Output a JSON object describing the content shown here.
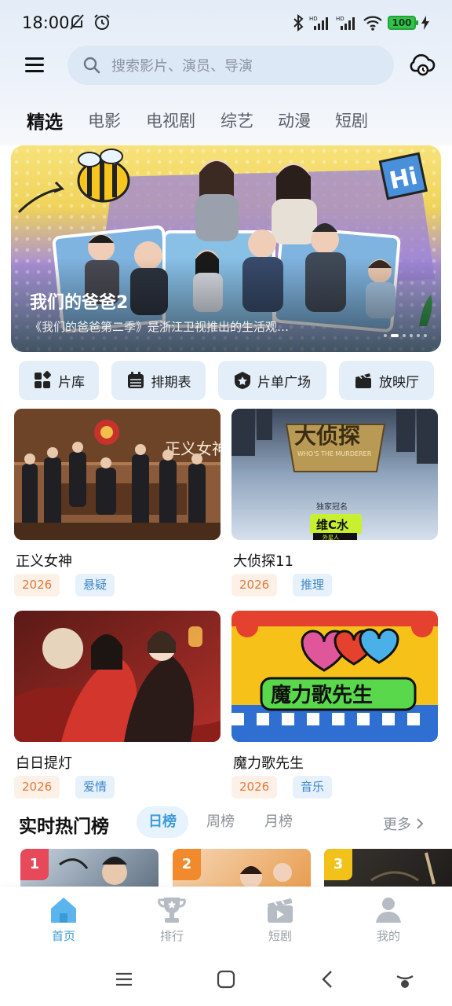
{
  "status_bar": {
    "time": "18:00",
    "battery": "100"
  },
  "search": {
    "placeholder": "搜索影片、演员、导演"
  },
  "category_tabs": [
    "精选",
    "电影",
    "电视剧",
    "综艺",
    "动漫",
    "短剧"
  ],
  "banner": {
    "title": "我们的爸爸2",
    "description": "《我们的爸爸第二季》是浙江卫视推出的生活观…"
  },
  "quick_links": [
    "片库",
    "排期表",
    "片单广场",
    "放映厅"
  ],
  "media": [
    {
      "title": "正义女神",
      "year": "2026",
      "genre": "悬疑"
    },
    {
      "title": "大侦探11",
      "year": "2026",
      "genre": "推理"
    },
    {
      "title": "白日提灯",
      "year": "2026",
      "genre": "爱情"
    },
    {
      "title": "魔力歌先生",
      "year": "2026",
      "genre": "音乐"
    }
  ],
  "thumb_texts": {
    "justice": "正义女神",
    "detective": "大侦探",
    "detective_sub": "WHO'S THE MURDERER",
    "sponsor_line": "独家冠名",
    "sponsor_brand": "维C水",
    "sponsor_small": "外星人",
    "magic": "魔力歌先生"
  },
  "ranking": {
    "title": "实时热门榜",
    "tabs": [
      "日榜",
      "周榜",
      "月榜"
    ],
    "more": "更多",
    "ranks": [
      "1",
      "2",
      "3"
    ]
  },
  "bottom_nav": [
    "首页",
    "排行",
    "短剧",
    "我的"
  ],
  "colors": {
    "accent": "#3d9ad9",
    "year_tag": "#e07a3a",
    "genre_tag": "#3d88c9"
  }
}
